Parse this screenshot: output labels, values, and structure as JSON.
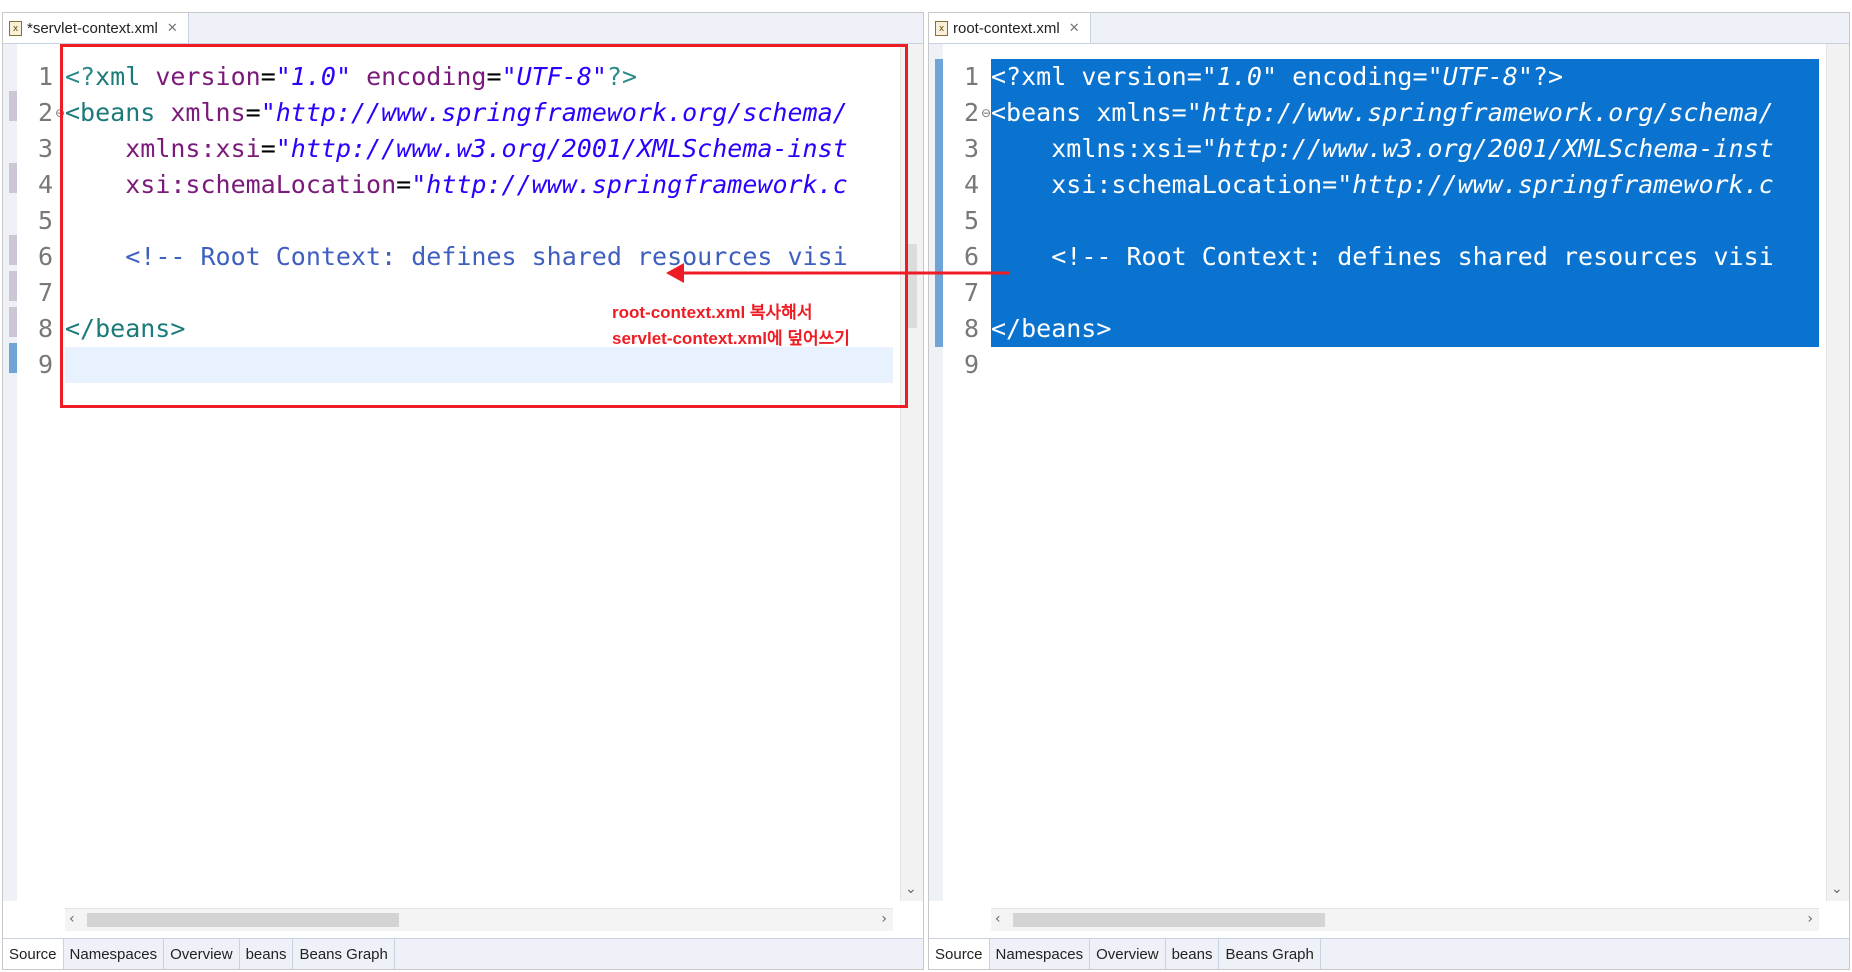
{
  "left_editor": {
    "tab_label": "*servlet-context.xml",
    "line_numbers": [
      "1",
      "2",
      "3",
      "4",
      "5",
      "6",
      "7",
      "8",
      "9"
    ],
    "lines": [
      [
        [
          "pi",
          "<?"
        ],
        [
          "tag",
          "xml "
        ],
        [
          "attr",
          "version"
        ],
        [
          "plain",
          "="
        ],
        [
          "val",
          "\"1.0\""
        ],
        [
          "plain",
          " "
        ],
        [
          "attr",
          "encoding"
        ],
        [
          "plain",
          "="
        ],
        [
          "val",
          "\"UTF-8\""
        ],
        [
          "pi",
          "?>"
        ]
      ],
      [
        [
          "tag",
          "<beans "
        ],
        [
          "attr",
          "xmlns"
        ],
        [
          "plain",
          "="
        ],
        [
          "val",
          "\"http://www.springframework.org/schema/"
        ]
      ],
      [
        [
          "plain",
          "    "
        ],
        [
          "attr",
          "xmlns:xsi"
        ],
        [
          "plain",
          "="
        ],
        [
          "val",
          "\"http://www.w3.org/2001/XMLSchema-inst"
        ]
      ],
      [
        [
          "plain",
          "    "
        ],
        [
          "attr",
          "xsi:schemaLocation"
        ],
        [
          "plain",
          "="
        ],
        [
          "val",
          "\"http://www.springframework.c"
        ]
      ],
      [],
      [
        [
          "plain",
          "    "
        ],
        [
          "cm",
          "<!-- Root Context: defines shared resources visi"
        ]
      ],
      [],
      [
        [
          "tag",
          "</beans>"
        ]
      ],
      []
    ],
    "bottom_tabs": [
      "Source",
      "Namespaces",
      "Overview",
      "beans",
      "Beans Graph"
    ]
  },
  "right_editor": {
    "tab_label": "root-context.xml",
    "line_numbers": [
      "1",
      "2",
      "3",
      "4",
      "5",
      "6",
      "7",
      "8",
      "9"
    ],
    "lines": [
      [
        [
          "pi",
          "<?"
        ],
        [
          "tag",
          "xml "
        ],
        [
          "attr",
          "version"
        ],
        [
          "plain",
          "="
        ],
        [
          "val",
          "\"1.0\""
        ],
        [
          "plain",
          " "
        ],
        [
          "attr",
          "encoding"
        ],
        [
          "plain",
          "="
        ],
        [
          "val",
          "\"UTF-8\""
        ],
        [
          "pi",
          "?>"
        ]
      ],
      [
        [
          "tag",
          "<beans "
        ],
        [
          "attr",
          "xmlns"
        ],
        [
          "plain",
          "="
        ],
        [
          "val",
          "\"http://www.springframework.org/schema/"
        ]
      ],
      [
        [
          "plain",
          "    "
        ],
        [
          "attr",
          "xmlns:xsi"
        ],
        [
          "plain",
          "="
        ],
        [
          "val",
          "\"http://www.w3.org/2001/XMLSchema-inst"
        ]
      ],
      [
        [
          "plain",
          "    "
        ],
        [
          "attr",
          "xsi:schemaLocation"
        ],
        [
          "plain",
          "="
        ],
        [
          "val",
          "\"http://www.springframework.c"
        ]
      ],
      [],
      [
        [
          "plain",
          "    "
        ],
        [
          "cm",
          "<!-- Root Context: defines shared resources visi"
        ]
      ],
      [],
      [
        [
          "tag",
          "</beans>"
        ]
      ],
      []
    ],
    "bottom_tabs": [
      "Source",
      "Namespaces",
      "Overview",
      "beans",
      "Beans Graph"
    ]
  },
  "annotation": {
    "line1": "root-context.xml 복사해서",
    "line2": "servlet-context.xml에 덮어쓰기",
    "color": "#ee1c24"
  },
  "colors": {
    "selection": "#0a73cf",
    "current_line": "#e8f2fe",
    "tag": "#1b7a7a",
    "attribute": "#7a1a7a",
    "value": "#2a00ff",
    "comment": "#3f5fbf"
  },
  "icons": {
    "file": "xml-file-icon",
    "close": "close-icon",
    "fold": "fold-collapse-icon",
    "scroll_left": "chevron-left-icon",
    "scroll_right": "chevron-right-icon",
    "scroll_down": "chevron-down-icon"
  }
}
